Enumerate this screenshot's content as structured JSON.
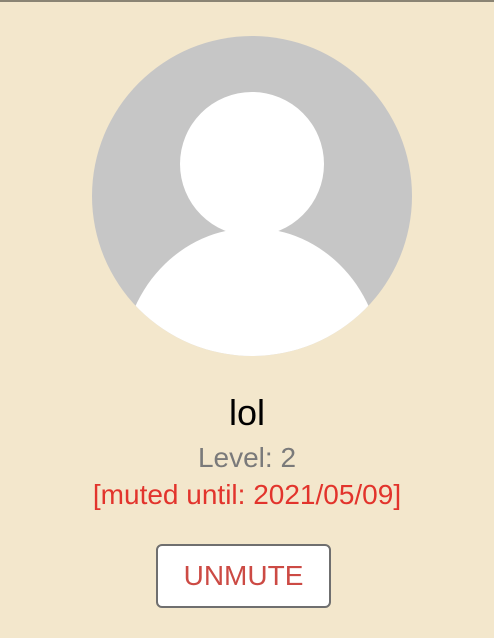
{
  "profile": {
    "username": "lol",
    "level_text": "Level: 2",
    "muted_text": "[muted until: 2021/05/09]",
    "unmute_label": "UNMUTE"
  },
  "theme": {
    "background": "#f3e7cc",
    "avatar_bg": "#c6c6c6",
    "avatar_figure": "#ffffff",
    "muted_color": "#e2342c",
    "button_text": "#cc4a44",
    "level_color": "#7a7a7a"
  },
  "icons": {
    "avatar": "default-user-silhouette-icon"
  }
}
